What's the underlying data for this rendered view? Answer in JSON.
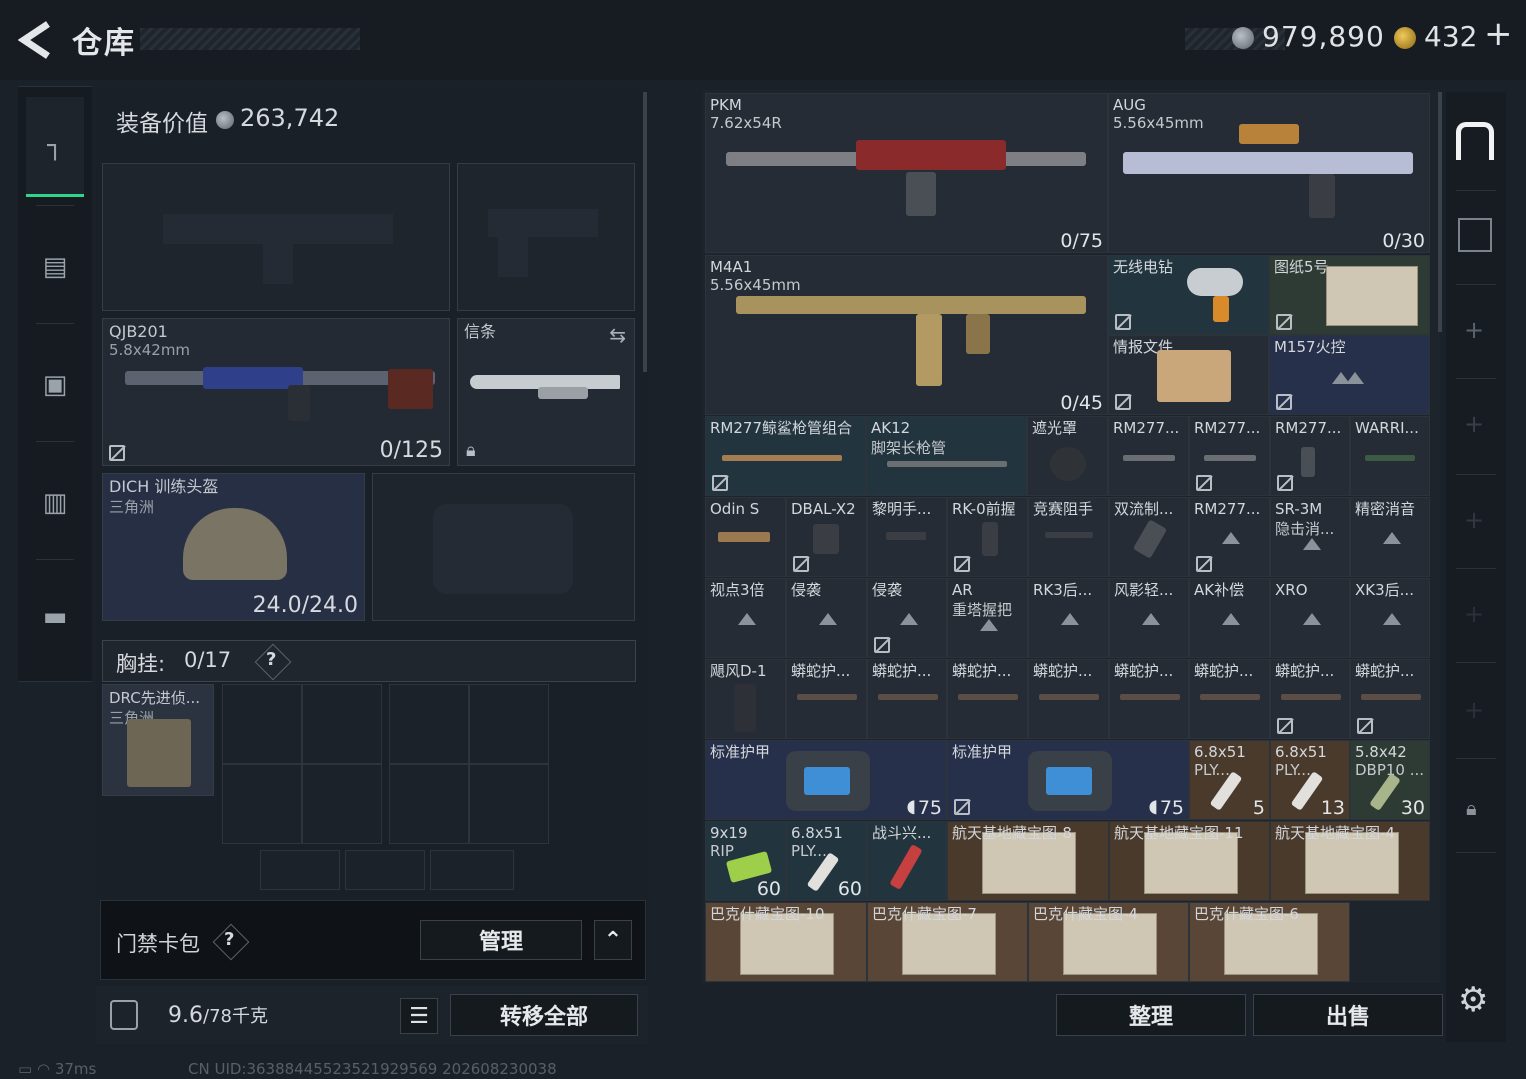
{
  "header": {
    "title": "仓库",
    "currency_silver": "979,890",
    "currency_gold": "432",
    "add_label": "+"
  },
  "equipment": {
    "value_label": "装备价值",
    "value": "263,742",
    "primary_weapon": {
      "name": "QJB201",
      "ammo": "5.8x42mm",
      "count": "0/125"
    },
    "melee": {
      "name": "信条"
    },
    "helmet": {
      "name": "DICH 训练头盔",
      "sub": "三角洲",
      "durability": "24.0/24.0"
    },
    "chest_label": "胸挂:",
    "chest_value": "0/17",
    "chest_rig": {
      "name": "DRC先进侦...",
      "sub": "三角洲"
    },
    "keycard_label": "门禁卡包",
    "manage_label": "管理",
    "weight": "9.6",
    "weight_max": "/78千克",
    "transfer_label": "转移全部"
  },
  "stash": {
    "weapons": [
      {
        "name": "PKM",
        "ammo": "7.62x54R",
        "count": "0/75"
      },
      {
        "name": "AUG",
        "ammo": "5.56x45mm",
        "count": "0/30"
      },
      {
        "name": "M4A1",
        "ammo": "5.56x45mm",
        "count": "0/45"
      }
    ],
    "items": {
      "drill": "无线电钻",
      "map5": "图纸5号",
      "intel": "情报文件",
      "m157": "M157火控",
      "r3": [
        "RM277鲸鲨枪管组合",
        "AK12",
        "遮光罩",
        "RM277...",
        "RM277...",
        "RM277...",
        "WARRI..."
      ],
      "r3_sub": "脚架长枪管",
      "r4": [
        "Odin S",
        "DBAL-X2",
        "黎明手...",
        "RK-0前握",
        "竞赛阻手",
        "双流制...",
        "RM277...",
        "SR-3M",
        "精密消音"
      ],
      "r4_sub": "隐击消...",
      "r5": [
        "视点3倍",
        "侵袭",
        "侵袭",
        "AR",
        "RK3后...",
        "风影轻...",
        "AK补偿",
        "XRO",
        "XK3后..."
      ],
      "r5_sub": "重塔握把",
      "r6": [
        "飓风D-1",
        "蟒蛇护...",
        "蟒蛇护...",
        "蟒蛇护...",
        "蟒蛇护...",
        "蟒蛇护...",
        "蟒蛇护...",
        "蟒蛇护...",
        "蟒蛇护..."
      ],
      "armor": {
        "name": "标准护甲",
        "value": "75"
      },
      "ammo1": {
        "name": "6.8x51",
        "sub": "PLY...",
        "count": "5"
      },
      "ammo2": {
        "name": "6.8x51",
        "sub": "PLY...",
        "count": "13"
      },
      "ammo3": {
        "name": "5.8x42",
        "sub": "DBP10 ...",
        "count": "30"
      },
      "ammo4": {
        "name": "9x19",
        "sub": "RIP",
        "count": "60"
      },
      "ammo5": {
        "name": "6.8x51",
        "sub": "PLY...",
        "count": "60"
      },
      "combat": "战斗兴...",
      "maps_top": [
        "航天基地藏宝图-8",
        "航天基地藏宝图-11",
        "航天基地藏宝图-4"
      ],
      "maps_bottom": [
        "巴克什藏宝图-10",
        "巴克什藏宝图-7",
        "巴克什藏宝图-4",
        "巴克什藏宝图-6"
      ]
    },
    "sort_label": "整理",
    "sell_label": "出售"
  },
  "status": {
    "ping": "37ms",
    "uid": "CN UID:3638844552352192956​9 2026082300​38"
  }
}
